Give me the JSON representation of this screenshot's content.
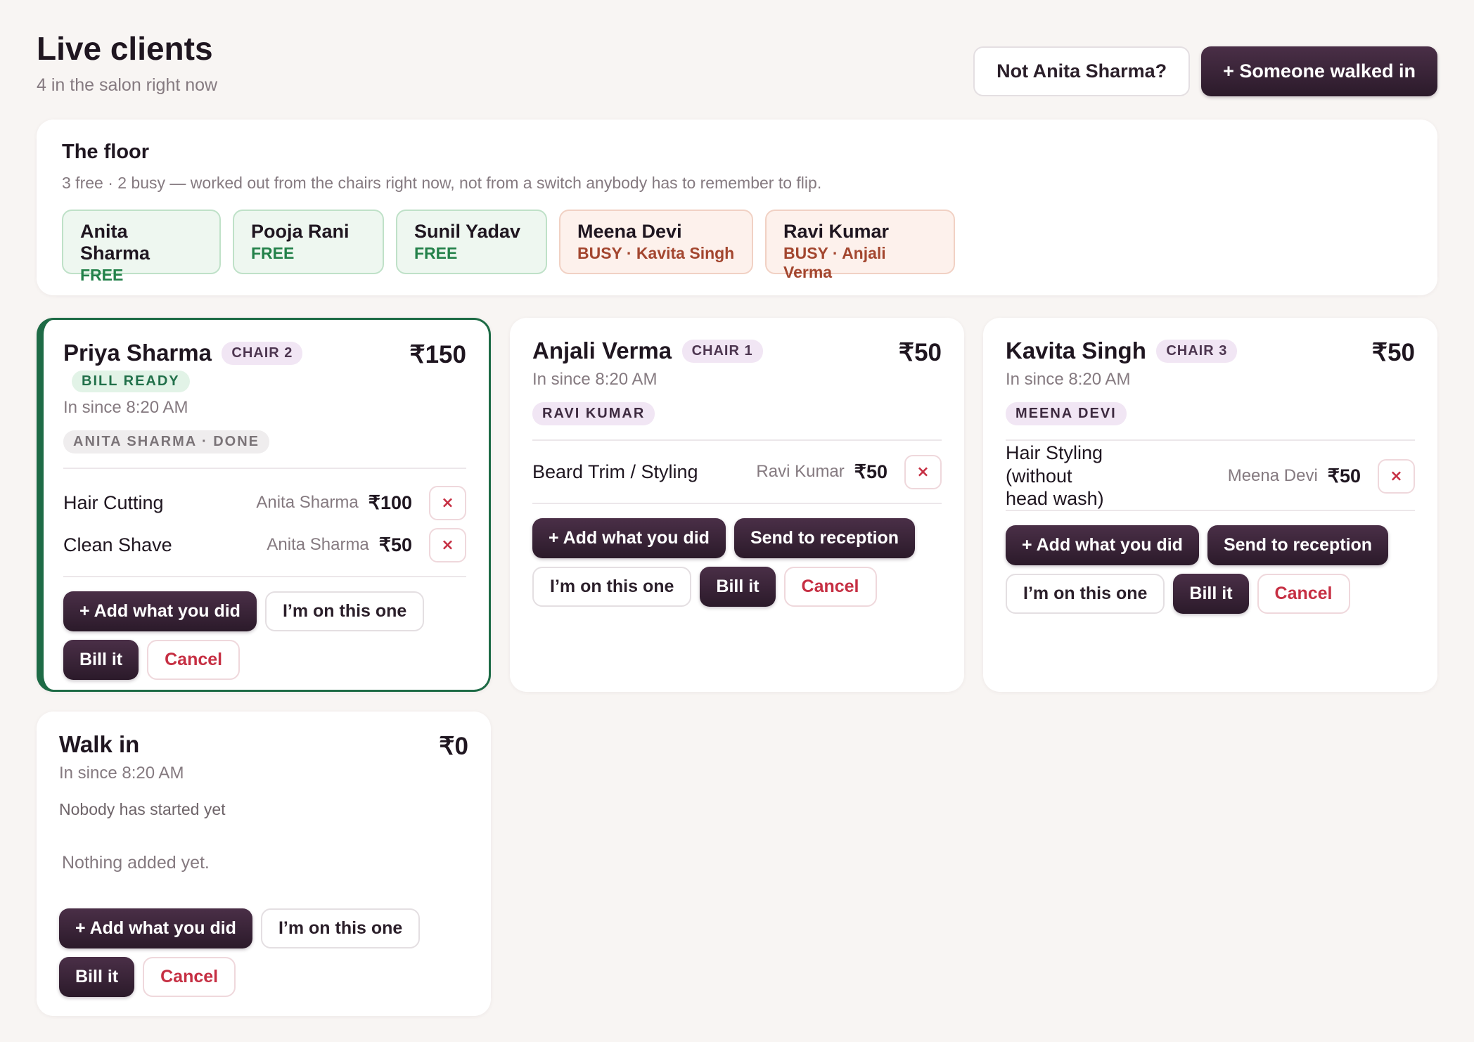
{
  "header": {
    "title": "Live clients",
    "subtitle": "4 in the salon right now",
    "not_user_label": "Not Anita Sharma?",
    "walked_in_label": "+ Someone walked in"
  },
  "floor": {
    "title": "The floor",
    "subtitle": "3 free · 2 busy — worked out from the chairs right now, not from a switch anybody has to remember to flip.",
    "stylists": [
      {
        "name": "Anita Sharma",
        "status": "FREE"
      },
      {
        "name": "Pooja Rani",
        "status": "FREE"
      },
      {
        "name": "Sunil Yadav",
        "status": "FREE"
      },
      {
        "name": "Meena Devi",
        "status": "BUSY · Kavita Singh"
      },
      {
        "name": "Ravi Kumar",
        "status": "BUSY · Anjali Verma"
      }
    ]
  },
  "labels": {
    "add": "+ Add what you did",
    "on_this": "I’m on this one",
    "bill": "Bill it",
    "cancel": "Cancel",
    "send": "Send to reception",
    "remove": "×"
  },
  "cards": [
    {
      "name": "Priya Sharma",
      "chair": "CHAIR 2",
      "ready": "BILL READY",
      "total": "₹150",
      "since": "In since 8:20 AM",
      "stylist": "ANITA SHARMA · DONE",
      "services": [
        {
          "name": "Hair Cutting",
          "by": "Anita Sharma",
          "price": "₹100"
        },
        {
          "name": "Clean Shave",
          "by": "Anita Sharma",
          "price": "₹50"
        }
      ]
    },
    {
      "name": "Anjali Verma",
      "chair": "CHAIR 1",
      "total": "₹50",
      "since": "In since 8:20 AM",
      "stylist": "RAVI KUMAR",
      "services": [
        {
          "name": "Beard Trim / Styling",
          "by": "Ravi Kumar",
          "price": "₹50"
        }
      ]
    },
    {
      "name": "Kavita Singh",
      "chair": "CHAIR 3",
      "total": "₹50",
      "since": "In since 8:20 AM",
      "stylist": "MEENA DEVI",
      "services": [
        {
          "name": "Hair Styling (without head wash)",
          "by": "Meena Devi",
          "price": "₹50"
        }
      ]
    },
    {
      "name": "Walk in",
      "total": "₹0",
      "since": "In since 8:20 AM",
      "nobody": "Nobody has started yet",
      "empty": "Nothing added yet."
    }
  ]
}
